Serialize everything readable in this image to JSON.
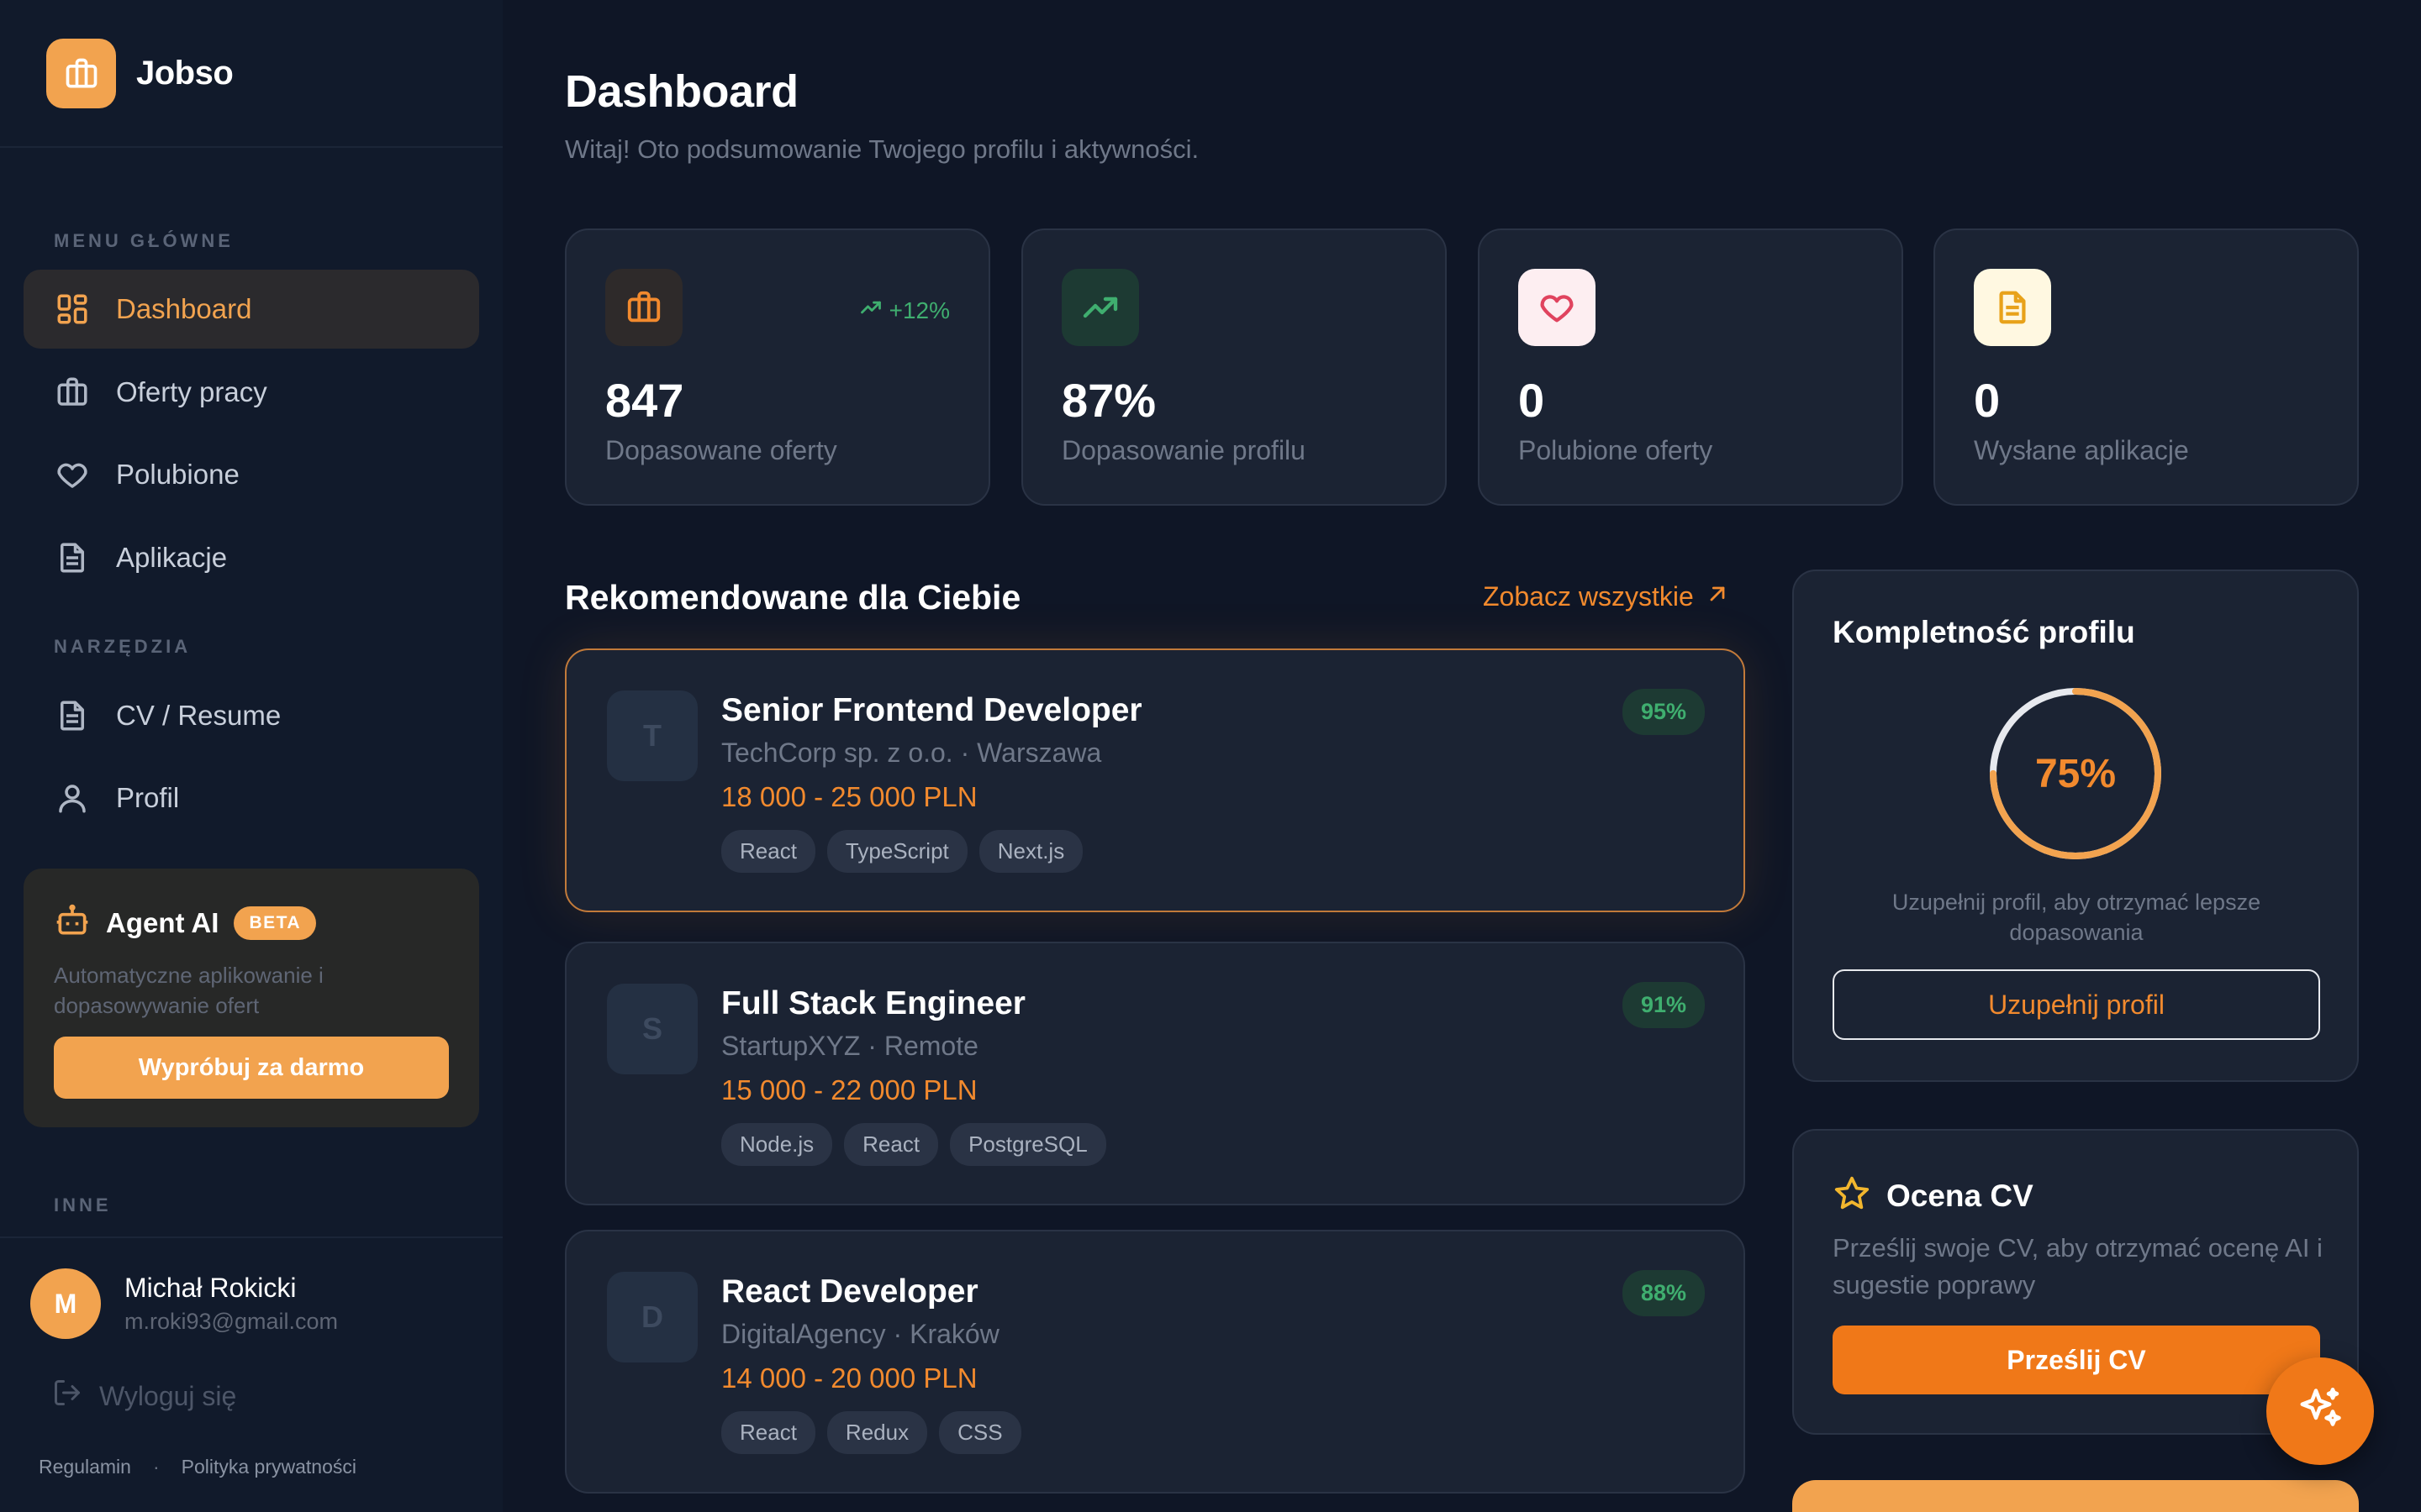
{
  "app": {
    "name": "Jobso"
  },
  "sidebar": {
    "section_main": "MENU GŁÓWNE",
    "section_tools": "NARZĘDZIA",
    "section_other": "INNE",
    "items": [
      {
        "label": "Dashboard",
        "icon": "dashboard-icon"
      },
      {
        "label": "Oferty pracy",
        "icon": "briefcase-icon"
      },
      {
        "label": "Polubione",
        "icon": "heart-icon"
      },
      {
        "label": "Aplikacje",
        "icon": "document-icon"
      }
    ],
    "tools": [
      {
        "label": "CV / Resume",
        "icon": "document-icon"
      },
      {
        "label": "Profil",
        "icon": "user-icon"
      }
    ],
    "agent": {
      "title": "Agent AI",
      "badge": "BETA",
      "description": "Automatyczne aplikowanie i dopasowywanie ofert",
      "button": "Wypróbuj za darmo"
    },
    "user": {
      "initial": "M",
      "name": "Michał Rokicki",
      "email": "m.roki93@gmail.com"
    },
    "logout": "Wyloguj się",
    "footer": {
      "terms": "Regulamin",
      "separator": "·",
      "privacy": "Polityka prywatności"
    }
  },
  "header": {
    "title": "Dashboard",
    "subtitle": "Witaj! Oto podsumowanie Twojego profilu i aktywności."
  },
  "stats": [
    {
      "value": "847",
      "label": "Dopasowane oferty",
      "trend": "+12%",
      "icon": "briefcase-icon"
    },
    {
      "value": "87%",
      "label": "Dopasowanie profilu",
      "icon": "trending-up-icon"
    },
    {
      "value": "0",
      "label": "Polubione oferty",
      "icon": "heart-icon"
    },
    {
      "value": "0",
      "label": "Wysłane aplikacje",
      "icon": "document-icon"
    }
  ],
  "recommended": {
    "title": "Rekomendowane dla Ciebie",
    "see_all": "Zobacz wszystkie",
    "jobs": [
      {
        "initial": "T",
        "title": "Senior Frontend Developer",
        "meta": "TechCorp sp. z o.o. · Warszawa",
        "salary": "18 000 - 25 000 PLN",
        "match": "95%",
        "tags": [
          "React",
          "TypeScript",
          "Next.js"
        ]
      },
      {
        "initial": "S",
        "title": "Full Stack Engineer",
        "meta": "StartupXYZ · Remote",
        "salary": "15 000 - 22 000 PLN",
        "match": "91%",
        "tags": [
          "Node.js",
          "React",
          "PostgreSQL"
        ]
      },
      {
        "initial": "D",
        "title": "React Developer",
        "meta": "DigitalAgency · Kraków",
        "salary": "14 000 - 20 000 PLN",
        "match": "88%",
        "tags": [
          "React",
          "Redux",
          "CSS"
        ]
      }
    ]
  },
  "profile_completeness": {
    "title": "Kompletność profilu",
    "percent_label": "75%",
    "percent": 0.75,
    "description": "Uzupełnij profil, aby otrzymać lepsze dopasowania",
    "button": "Uzupełnij profil"
  },
  "cv_rating": {
    "title": "Ocena CV",
    "description": "Prześlij swoje CV, aby otrzymać ocenę AI i sugestie poprawy",
    "button": "Prześlij CV"
  },
  "colors": {
    "accent": "#f2a34f",
    "accent_strong": "#f07818",
    "success": "#3fae6f",
    "background": "#0f1626",
    "card": "#1b2333"
  }
}
